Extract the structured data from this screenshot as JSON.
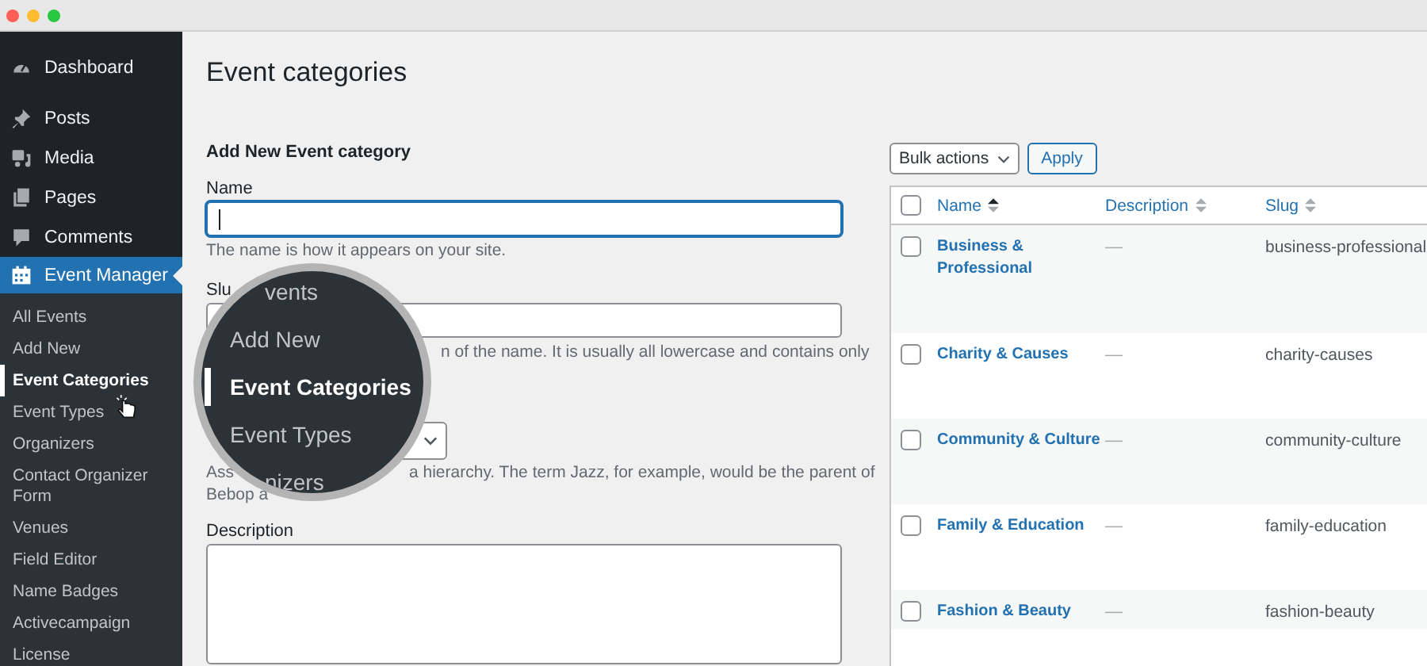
{
  "sidebar": {
    "items": [
      {
        "label": "Dashboard",
        "selected": false
      },
      {
        "label": "Posts",
        "selected": false
      },
      {
        "label": "Media",
        "selected": false
      },
      {
        "label": "Pages",
        "selected": false
      },
      {
        "label": "Comments",
        "selected": false
      },
      {
        "label": "Event Manager",
        "selected": true,
        "submenu": [
          {
            "label": "All Events",
            "selected": false
          },
          {
            "label": "Add New",
            "selected": false
          },
          {
            "label": "Event Categories",
            "selected": true
          },
          {
            "label": "Event Types",
            "selected": false
          },
          {
            "label": "Organizers",
            "selected": false
          },
          {
            "label": "Contact Organizer Form",
            "selected": false
          },
          {
            "label": "Venues",
            "selected": false
          },
          {
            "label": "Field Editor",
            "selected": false
          },
          {
            "label": "Name Badges",
            "selected": false
          },
          {
            "label": "Activecampaign",
            "selected": false
          },
          {
            "label": "License",
            "selected": false
          }
        ]
      }
    ]
  },
  "page_title": "Event categories",
  "form": {
    "title": "Add New Event category",
    "name": {
      "label": "Name",
      "focused": true,
      "hint": "The name is how it appears on your site."
    },
    "slug": {
      "label": "Slu",
      "hint": "n of the name. It is usually all lowercase and contains only"
    },
    "parent": {
      "hint_lead": "Ass",
      "hint_rest": "a hierarchy. The term Jazz, for example, would be the parent of",
      "hint_line2": "Bebop a"
    },
    "description": {
      "label": "Description"
    }
  },
  "magnifier": {
    "items": [
      {
        "label": "vents",
        "selected": false
      },
      {
        "label": "Add New",
        "selected": false
      },
      {
        "label": "Event Categories",
        "selected": true
      },
      {
        "label": "Event Types",
        "selected": false
      },
      {
        "label": "nizers",
        "selected": false
      }
    ]
  },
  "table": {
    "bulk_actions": "Bulk actions",
    "apply": "Apply",
    "select_all_checked": false,
    "columns": [
      {
        "label": "Name",
        "sorted": true
      },
      {
        "label": "Description",
        "sorted": false
      },
      {
        "label": "Slug",
        "sorted": false
      }
    ],
    "rows": [
      {
        "name": "Business & Professional",
        "description": "—",
        "slug": "business-professional",
        "checked": false
      },
      {
        "name": "Charity & Causes",
        "description": "—",
        "slug": "charity-causes",
        "checked": false
      },
      {
        "name": "Community & Culture",
        "description": "—",
        "slug": "community-culture",
        "checked": false
      },
      {
        "name": "Family & Education",
        "description": "—",
        "slug": "family-education",
        "checked": false
      },
      {
        "name": "Fashion & Beauty",
        "description": "—",
        "slug": "fashion-beauty",
        "checked": false
      }
    ]
  }
}
